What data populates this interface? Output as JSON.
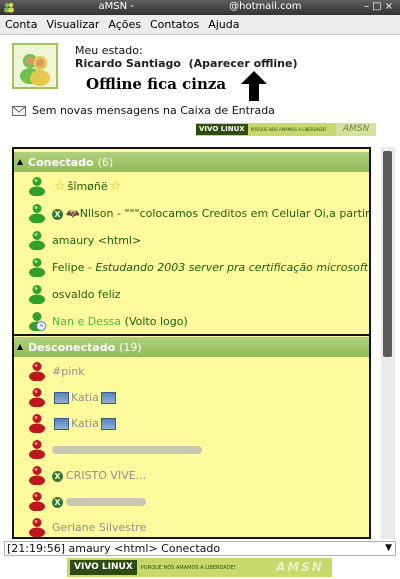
{
  "window": {
    "title": "aMSN - ",
    "title_suffix": "@hotmail.com"
  },
  "menu": [
    "Conta",
    "Visualizar",
    "Ações",
    "Contatos",
    "Ajuda"
  ],
  "status": {
    "label": "Meu estado:",
    "nick": "Ricardo Santiago",
    "state": "(Aparecer offline)"
  },
  "annotation": "Offline fica cinza",
  "mail": "Sem novas mensagens na Caixa de Entrada",
  "banners": {
    "brand": "VIVO LINUX",
    "slogan": "PORQUE NÓS AMAMOS A LIBERDADE!",
    "app": "AMSN"
  },
  "groups": [
    {
      "name": "Conectado",
      "count": "(6)",
      "contacts": [
        {
          "text": "šîmøñë",
          "prefix_star": true,
          "suffix_star": true,
          "status": "online"
        },
        {
          "text": "Nllson - \"\"\"colocamos Creditos em Celular Oi,a partir de ...",
          "x_icon": true,
          "status": "online"
        },
        {
          "text": "amaury <html>",
          "status": "online"
        },
        {
          "name": "Felipe - ",
          "psm": "Estudando 2003 server pra certificação microsoft",
          "status": "online"
        },
        {
          "text": "osvaldo feliz",
          "status": "online"
        },
        {
          "name": "Nan e Dessa",
          "psm": " (Volto logo)",
          "status": "away"
        }
      ]
    },
    {
      "name": "Desconectado",
      "count": "(19)",
      "contacts": [
        {
          "text": "#pink",
          "status": "offline"
        },
        {
          "text": "Katia",
          "pics": true,
          "status": "offline"
        },
        {
          "text": "Katia",
          "pics": true,
          "status": "offline"
        },
        {
          "text": "",
          "blur": true,
          "status": "offline"
        },
        {
          "text": "CRISTO VIVE...",
          "x_icon": true,
          "status": "offline"
        },
        {
          "text": "",
          "blur": true,
          "x_icon": true,
          "status": "offline"
        },
        {
          "text": "Gerlane Silvestre",
          "status": "offline"
        }
      ]
    }
  ],
  "status_bar": "[21:19:56] amaury <html> Conectado",
  "colors": {
    "list_bg": "#fefb9c",
    "group_header": "#9ec266",
    "online_text": "#1b5e0f",
    "offline_text": "#909090",
    "online_icon": "#2fa12a",
    "offline_icon": "#c0151f"
  }
}
